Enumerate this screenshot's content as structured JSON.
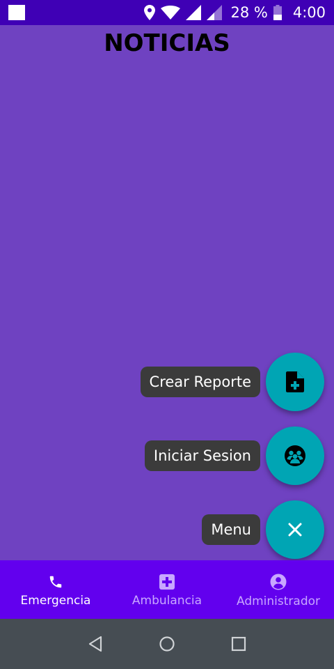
{
  "status_bar": {
    "battery_percent": "28 %",
    "time": "4:00",
    "icons": [
      "notification-square-icon",
      "location-icon",
      "wifi-icon",
      "signal-icon",
      "signal-weak-icon",
      "battery-icon"
    ]
  },
  "header": {
    "title": "NOTICIAS"
  },
  "speed_dial": {
    "items": [
      {
        "label": "Crear Reporte",
        "icon": "add-document-icon"
      },
      {
        "label": "Iniciar Sesion",
        "icon": "user-group-icon"
      },
      {
        "label": "Menu",
        "icon": "close-icon"
      }
    ],
    "fab_color": "#00a5b4"
  },
  "bottom_nav": {
    "items": [
      {
        "label": "Emergencia",
        "icon": "phone-icon",
        "active": true
      },
      {
        "label": "Ambulancia",
        "icon": "medical-cross-icon",
        "active": false
      },
      {
        "label": "Administrador",
        "icon": "account-icon",
        "active": false
      }
    ],
    "background": "#6200ee"
  },
  "colors": {
    "page_background": "#6f42c1",
    "status_bar": "#3f00b5",
    "system_nav": "#464d53"
  }
}
